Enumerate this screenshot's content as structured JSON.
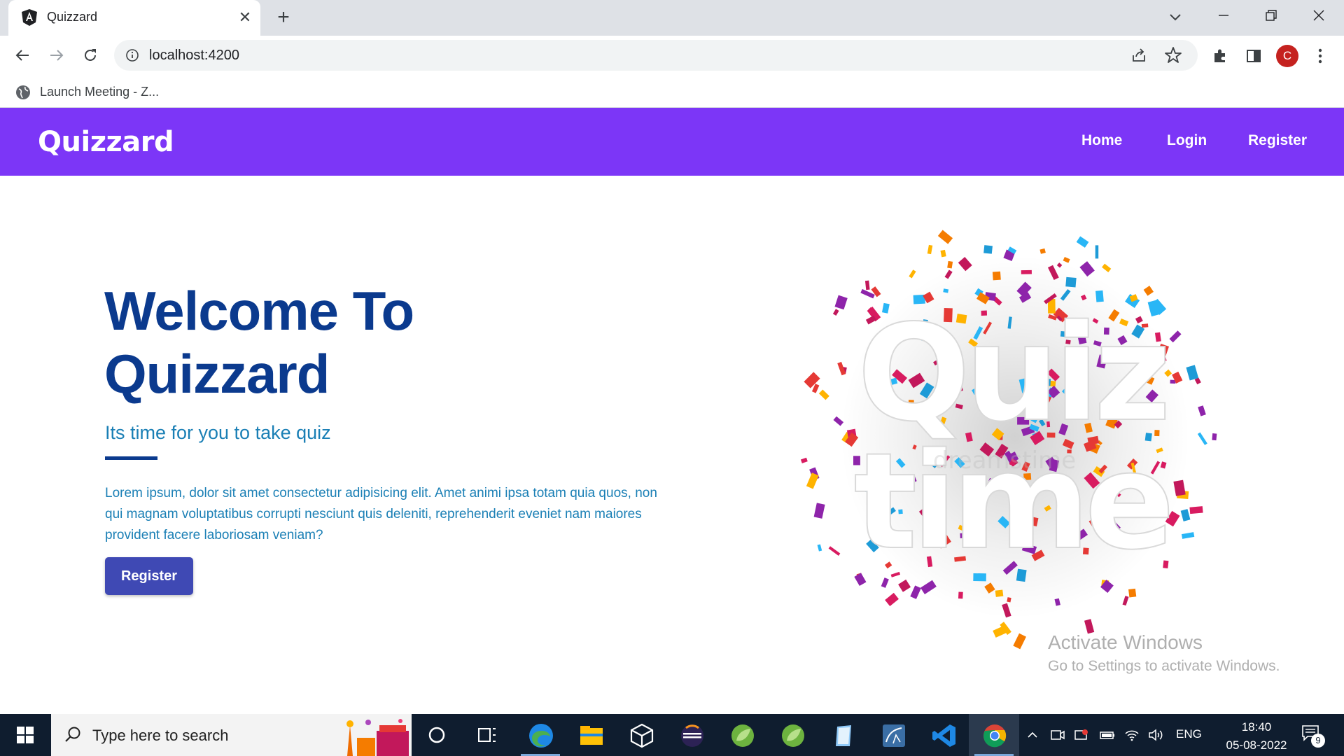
{
  "browser": {
    "tab_title": "Quizzard",
    "url": "localhost:4200",
    "bookmark_label": "Launch Meeting - Z...",
    "profile_initial": "C"
  },
  "navbar": {
    "brand": "Quizzard",
    "links": [
      "Home",
      "Login",
      "Register"
    ],
    "background": "#7c36f7"
  },
  "hero": {
    "title_line1": "Welcome To",
    "title_line2": "Quizzard",
    "subtitle": "Its time for you to take quiz",
    "body": "Lorem ipsum, dolor sit amet consectetur adipisicing elit. Amet animi ipsa totam quia quos, non qui magnam voluptatibus corrupti nesciunt quis deleniti, reprehenderit eveniet nam maiores provident facere laboriosam veniam?",
    "button_label": "Register",
    "title_color": "#0b3a8e",
    "text_color": "#1a7fb5",
    "button_color": "#3f49b4"
  },
  "illustration": {
    "line1": "Quiz",
    "line2": "time",
    "watermark": "dreamstime"
  },
  "watermark": {
    "title": "Activate Windows",
    "subtitle": "Go to Settings to activate Windows."
  },
  "taskbar": {
    "search_placeholder": "Type here to search",
    "language": "ENG",
    "time": "18:40",
    "date": "05-08-2022",
    "notification_count": "9",
    "apps": [
      "cortana-icon",
      "task-view-icon",
      "edge-icon",
      "file-explorer-icon",
      "package-icon",
      "eclipse-icon",
      "spring-tool-icon",
      "spring-tool-icon",
      "notepad-icon",
      "mysql-workbench-icon",
      "vscode-icon",
      "chrome-icon"
    ]
  }
}
